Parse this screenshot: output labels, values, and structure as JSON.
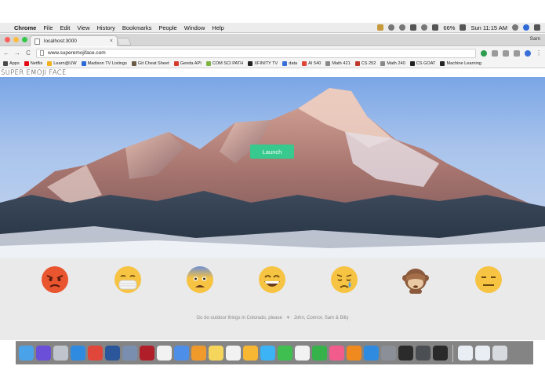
{
  "menubar": {
    "app_name": "Chrome",
    "items": [
      "File",
      "Edit",
      "View",
      "History",
      "Bookmarks",
      "People",
      "Window",
      "Help"
    ],
    "battery": "66%",
    "clock": "Sun 11:15 AM"
  },
  "browser": {
    "tab_title": "localhost:3000",
    "tab_close": "×",
    "profile_name": "Sam",
    "url": "www.superemojiface.com",
    "back": "←",
    "forward": "→",
    "reload": "C",
    "menu": "⋮"
  },
  "bookmarks": [
    {
      "label": "Apps",
      "color": "#4a4a4a"
    },
    {
      "label": "Netflix",
      "color": "#e50914"
    },
    {
      "label": "Learn@UW",
      "color": "#f2b01e"
    },
    {
      "label": "Madison TV Listings",
      "color": "#2f6ad6"
    },
    {
      "label": "Git Cheat Sheet",
      "color": "#6b5b45"
    },
    {
      "label": "Genda API",
      "color": "#d63a2f"
    },
    {
      "label": "COM SCI PATH",
      "color": "#7cb342"
    },
    {
      "label": "XFINITY TV",
      "color": "#222222"
    },
    {
      "label": "data",
      "color": "#3a6fd8"
    },
    {
      "label": "AI 540",
      "color": "#e0453a"
    },
    {
      "label": "Math 421",
      "color": "#888888"
    },
    {
      "label": "CS 252",
      "color": "#c0392b"
    },
    {
      "label": "Math 240",
      "color": "#888888"
    },
    {
      "label": "CS GOAT",
      "color": "#222222"
    },
    {
      "label": "Machine Learning",
      "color": "#222222"
    }
  ],
  "site": {
    "title": "SUPER EMOJI FACE",
    "launch_label": "Launch",
    "accent": "#38c98e",
    "footer_left": "Go do outdoor things in Colorado, please",
    "footer_heart": "♥",
    "footer_right": "John, Connor, Sam & Billy"
  },
  "emojis": [
    {
      "name": "angry"
    },
    {
      "name": "mask"
    },
    {
      "name": "fearful"
    },
    {
      "name": "grinning"
    },
    {
      "name": "crying"
    },
    {
      "name": "see-no-evil-monkey"
    },
    {
      "name": "expressionless"
    }
  ],
  "dock": {
    "apps": [
      "finder",
      "siri",
      "launchpad",
      "safari",
      "chrome",
      "word",
      "preview",
      "photo-booth",
      "calendar",
      "keynote",
      "pages",
      "notes",
      "reminders",
      "photos",
      "messages",
      "facetime",
      "texteditor",
      "numbers",
      "itunes",
      "ibooks",
      "app-store",
      "system-preferences",
      "terminal",
      "sublime",
      "iterm"
    ],
    "folders": [
      "documents",
      "downloads"
    ],
    "trash": "trash"
  }
}
